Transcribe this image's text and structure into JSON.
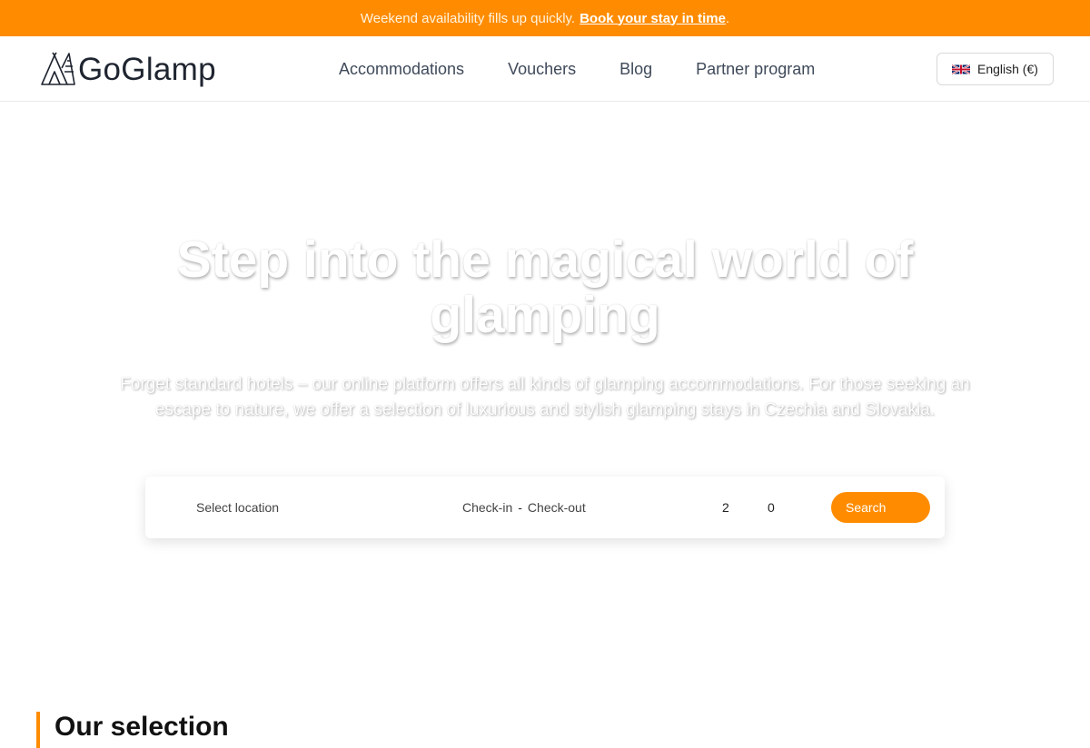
{
  "announcement": {
    "message": "Weekend availability fills up quickly.",
    "cta": "Book your stay in time",
    "trailing": "."
  },
  "header": {
    "logo_text": "GoGlamp",
    "nav": [
      {
        "label": "Accommodations"
      },
      {
        "label": "Vouchers"
      },
      {
        "label": "Blog"
      },
      {
        "label": "Partner program"
      }
    ],
    "language": {
      "label": "English (€)",
      "flag": "uk-flag-icon"
    }
  },
  "hero": {
    "title": "Step into the magical world of glamping",
    "subtitle": "Forget standard hotels – our online platform offers all kinds of glamping accommodations. For those seeking an escape to nature, we offer a selection of luxurious and stylish glamping stays in Czechia and Slovakia."
  },
  "search": {
    "location_placeholder": "Select location",
    "checkin_label": "Check-in",
    "date_separator": "-",
    "checkout_label": "Check-out",
    "adults_count": "2",
    "children_count": "0",
    "button_label": "Search"
  },
  "section": {
    "title": "Our selection"
  },
  "colors": {
    "accent": "#ff8c00",
    "text_dark": "#1f2530",
    "nav_text": "#3f4a5a"
  }
}
